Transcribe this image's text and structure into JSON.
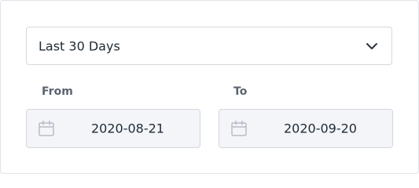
{
  "range": {
    "selected": "Last 30 Days",
    "icon": "chevron-down-icon"
  },
  "from": {
    "label": "From",
    "value": "2020-08-21",
    "icon": "calendar-icon"
  },
  "to": {
    "label": "To",
    "value": "2020-09-20",
    "icon": "calendar-icon"
  },
  "colors": {
    "border": "#d3d7de",
    "field_background": "#f3f5f9",
    "label": "#5b6470",
    "text": "#1f2933"
  }
}
